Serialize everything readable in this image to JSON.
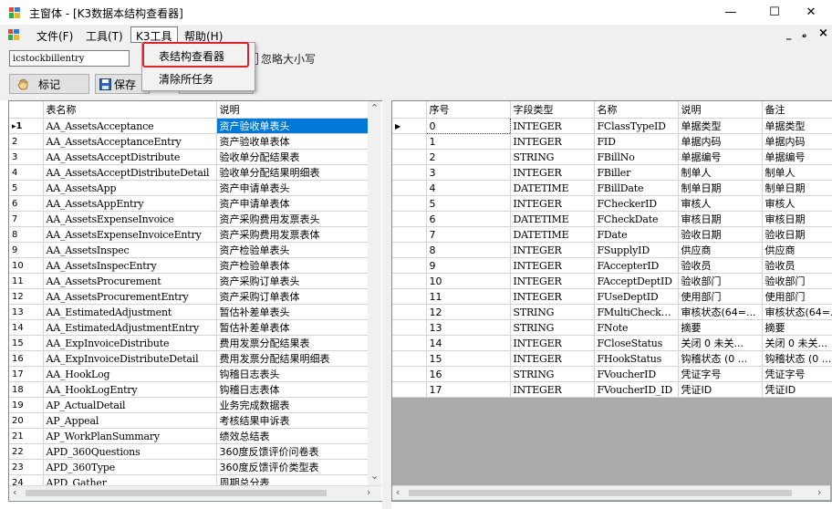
{
  "window": {
    "title": "主窗体 - [K3数据本结构查看器]",
    "minimize_glyph": "—",
    "maximize_glyph": "☐",
    "close_glyph": "✕"
  },
  "menu": {
    "items": [
      "文件(F)",
      "工具(T)",
      "K3工具",
      "帮助(H)"
    ],
    "mdi_min": "_",
    "mdi_restore": "ₑ",
    "mdi_close": "×"
  },
  "dropdown": {
    "items": [
      "表结构查看器",
      "清除所任务"
    ]
  },
  "toolbar": {
    "search_value": "icstockbillentry",
    "checkbox_label": "忽略大小写",
    "mark_label": "标记",
    "save_label": "保存"
  },
  "left_grid": {
    "headers": [
      "表名称",
      "说明"
    ],
    "selected_row": 1,
    "rows": [
      {
        "n": "1",
        "name": "AA_AssetsAcceptance",
        "desc": "资产验收单表头"
      },
      {
        "n": "2",
        "name": "AA_AssetsAcceptanceEntry",
        "desc": "资产验收单表体"
      },
      {
        "n": "3",
        "name": "AA_AssetsAcceptDistribute",
        "desc": "验收单分配结果表"
      },
      {
        "n": "4",
        "name": "AA_AssetsAcceptDistributeDetail",
        "desc": "验收单分配结果明细表"
      },
      {
        "n": "5",
        "name": "AA_AssetsApp",
        "desc": "资产申请单表头"
      },
      {
        "n": "6",
        "name": "AA_AssetsAppEntry",
        "desc": "资产申请单表体"
      },
      {
        "n": "7",
        "name": "AA_AssetsExpenseInvoice",
        "desc": "资产采购费用发票表头"
      },
      {
        "n": "8",
        "name": "AA_AssetsExpenseInvoiceEntry",
        "desc": "资产采购费用发票表体"
      },
      {
        "n": "9",
        "name": "AA_AssetsInspec",
        "desc": "资产检验单表头"
      },
      {
        "n": "10",
        "name": "AA_AssetsInspecEntry",
        "desc": "资产检验单表体"
      },
      {
        "n": "11",
        "name": "AA_AssetsProcurement",
        "desc": "资产采购订单表头"
      },
      {
        "n": "12",
        "name": "AA_AssetsProcurementEntry",
        "desc": "资产采购订单表体"
      },
      {
        "n": "13",
        "name": "AA_EstimatedAdjustment",
        "desc": "暂估补差单表头"
      },
      {
        "n": "14",
        "name": "AA_EstimatedAdjustmentEntry",
        "desc": "暂估补差单表体"
      },
      {
        "n": "15",
        "name": "AA_ExpInvoiceDistribute",
        "desc": "费用发票分配结果表"
      },
      {
        "n": "16",
        "name": "AA_ExpInvoiceDistributeDetail",
        "desc": "费用发票分配结果明细表"
      },
      {
        "n": "17",
        "name": "AA_HookLog",
        "desc": "钩稽日志表头"
      },
      {
        "n": "18",
        "name": "AA_HookLogEntry",
        "desc": "钩稽日志表体"
      },
      {
        "n": "19",
        "name": "AP_ActualDetail",
        "desc": "业务完成数据表"
      },
      {
        "n": "20",
        "name": "AP_Appeal",
        "desc": "考核结果申诉表"
      },
      {
        "n": "21",
        "name": "AP_WorkPlanSummary",
        "desc": "绩效总结表"
      },
      {
        "n": "22",
        "name": "APD_360Questions",
        "desc": "360度反馈评价问卷表"
      },
      {
        "n": "23",
        "name": "APD_360Type",
        "desc": "360度反馈评价类型表"
      },
      {
        "n": "24",
        "name": "APD_Gather",
        "desc": "周期总分表"
      }
    ]
  },
  "right_grid": {
    "headers": [
      "序号",
      "字段类型",
      "名称",
      "说明",
      "备注"
    ],
    "rows": [
      {
        "n": "0",
        "type": "INTEGER",
        "name": "FClassTypeID",
        "desc": "单据类型",
        "note": "单据类型"
      },
      {
        "n": "1",
        "type": "INTEGER",
        "name": "FID",
        "desc": "单据内码",
        "note": "单据内码"
      },
      {
        "n": "2",
        "type": "STRING",
        "name": "FBillNo",
        "desc": "单据编号",
        "note": "单据编号"
      },
      {
        "n": "3",
        "type": "INTEGER",
        "name": "FBiller",
        "desc": "制单人",
        "note": "制单人"
      },
      {
        "n": "4",
        "type": "DATETIME",
        "name": "FBillDate",
        "desc": "制单日期",
        "note": "制单日期"
      },
      {
        "n": "5",
        "type": "INTEGER",
        "name": "FCheckerID",
        "desc": "审核人",
        "note": "审核人"
      },
      {
        "n": "6",
        "type": "DATETIME",
        "name": "FCheckDate",
        "desc": "审核日期",
        "note": "审核日期"
      },
      {
        "n": "7",
        "type": "DATETIME",
        "name": "FDate",
        "desc": "验收日期",
        "note": "验收日期"
      },
      {
        "n": "8",
        "type": "INTEGER",
        "name": "FSupplyID",
        "desc": "供应商",
        "note": "供应商"
      },
      {
        "n": "9",
        "type": "INTEGER",
        "name": "FAccepterID",
        "desc": "验收员",
        "note": "验收员"
      },
      {
        "n": "10",
        "type": "INTEGER",
        "name": "FAcceptDeptID",
        "desc": "验收部门",
        "note": "验收部门"
      },
      {
        "n": "11",
        "type": "INTEGER",
        "name": "FUseDeptID",
        "desc": "使用部门",
        "note": "使用部门"
      },
      {
        "n": "12",
        "type": "STRING",
        "name": "FMultiCheckS...",
        "desc": "审核状态(64=...",
        "note": "审核状态(64=..."
      },
      {
        "n": "13",
        "type": "STRING",
        "name": "FNote",
        "desc": "摘要",
        "note": "摘要"
      },
      {
        "n": "14",
        "type": "INTEGER",
        "name": "FCloseStatus",
        "desc": "关闭 0 未关...",
        "note": "关闭 0 未关..."
      },
      {
        "n": "15",
        "type": "INTEGER",
        "name": "FHookStatus",
        "desc": "钩稽状态 (0 ...",
        "note": "钩稽状态 (0 ..."
      },
      {
        "n": "16",
        "type": "STRING",
        "name": "FVoucherID",
        "desc": "凭证字号",
        "note": "凭证字号"
      },
      {
        "n": "17",
        "type": "INTEGER",
        "name": "FVoucherID_ID",
        "desc": "凭证ID",
        "note": "凭证ID"
      }
    ]
  },
  "colors": {
    "selection": "#0078d7",
    "highlight_box": "#e0202a",
    "chrome": "#f0f0f0"
  }
}
